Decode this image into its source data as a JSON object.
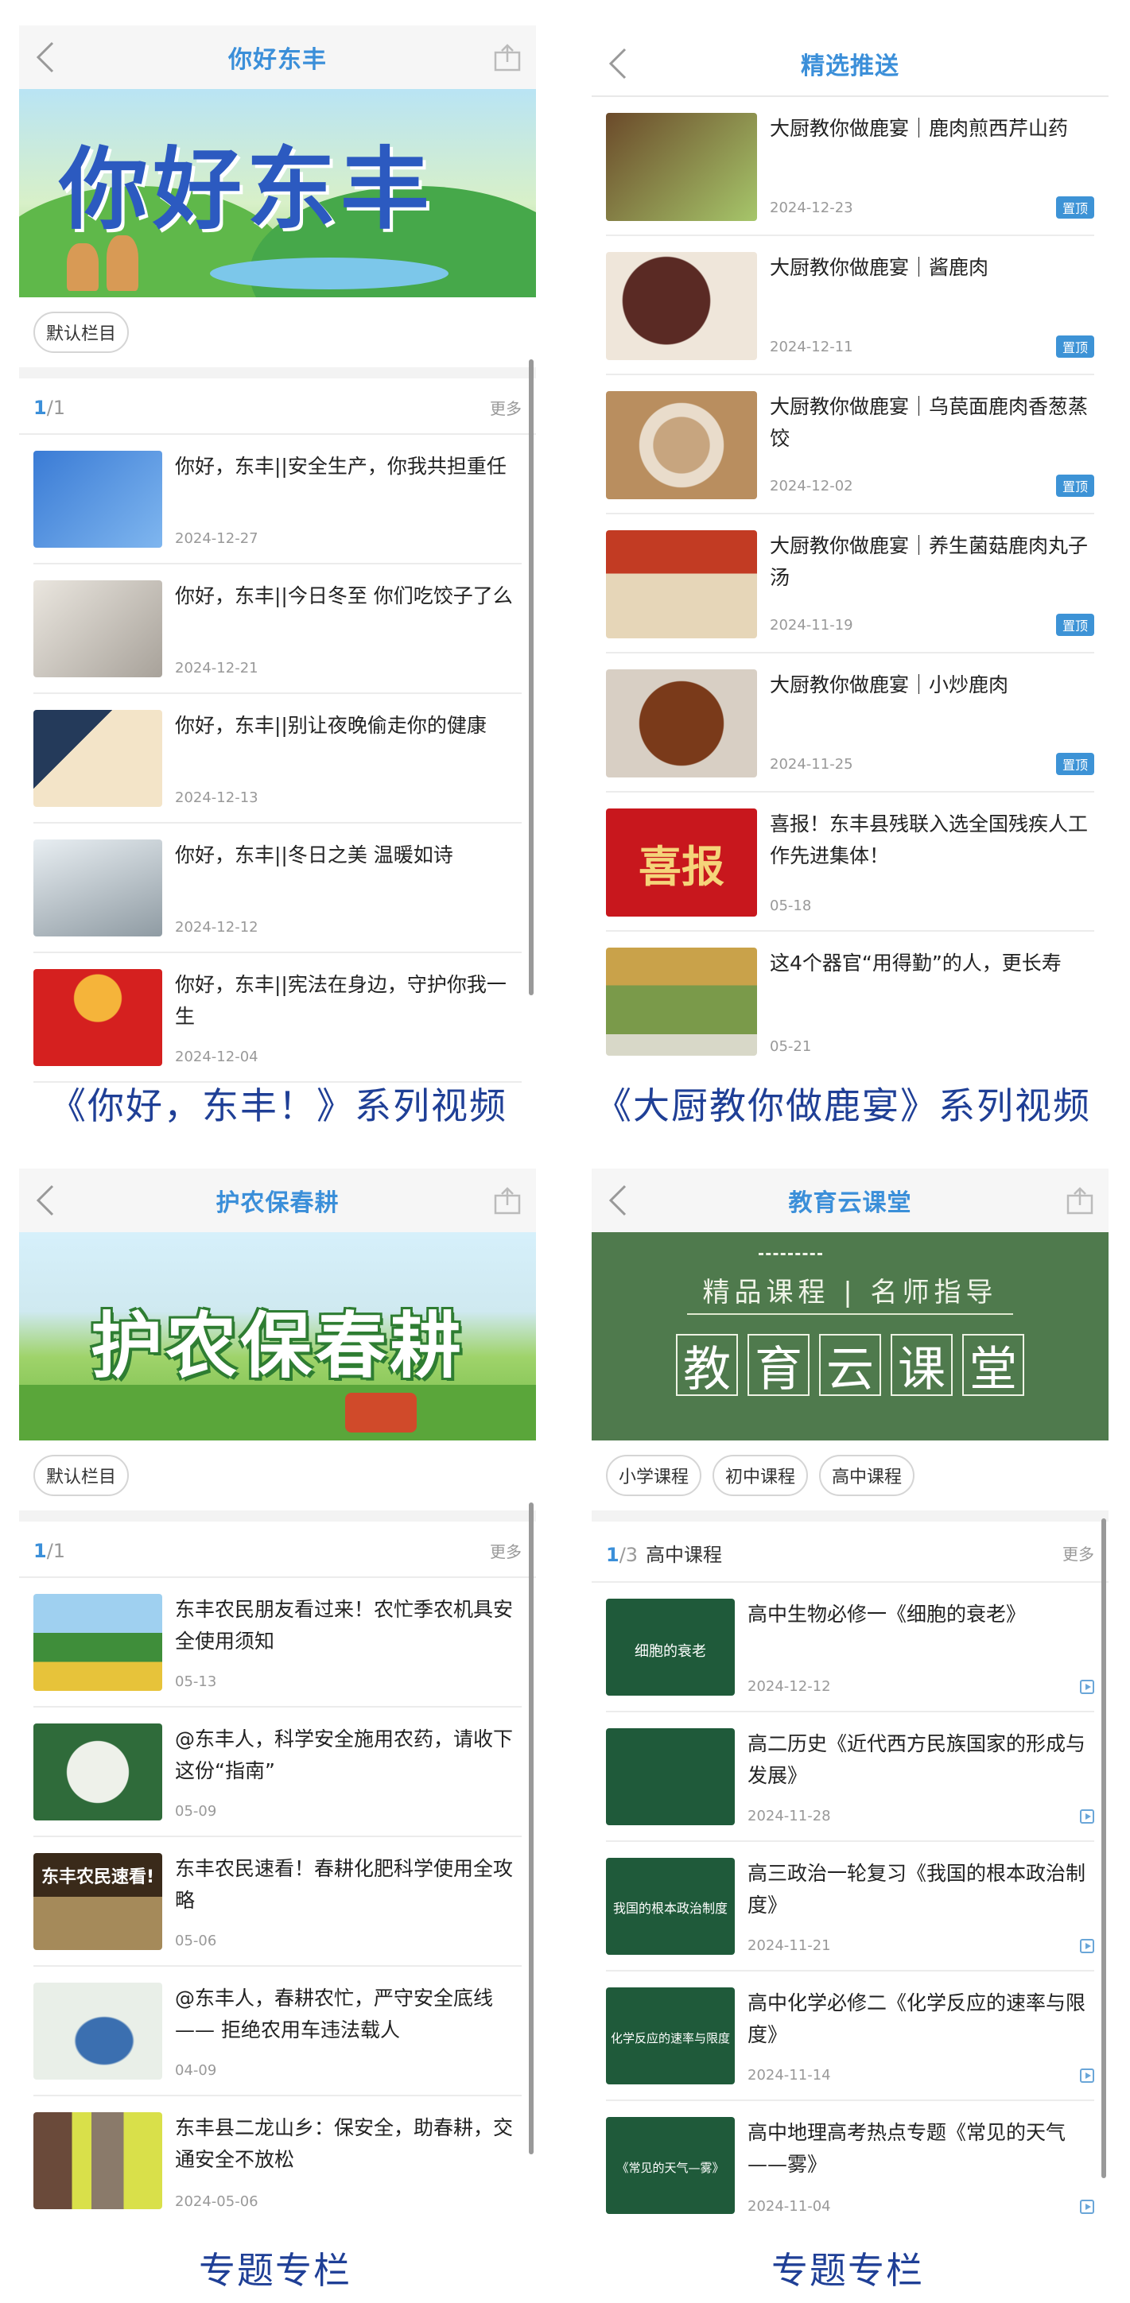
{
  "panels": [
    {
      "title": "你好东丰",
      "chips": [
        "默认栏目"
      ],
      "page_current": "1",
      "page_total": "/1",
      "more": "更多",
      "banner_text": "你好东丰",
      "items": [
        {
          "title": "你好，东丰||安全生产，你我共担重任",
          "date": "2024-12-27",
          "thumb_color": "#3a7bd5"
        },
        {
          "title": "你好，东丰||今日冬至 你们吃饺子了么",
          "date": "2024-12-21",
          "thumb_color": "#d8d2c8"
        },
        {
          "title": "你好，东丰||别让夜晚偷走你的健康",
          "date": "2024-12-13",
          "thumb_color": "#f1e2c6"
        },
        {
          "title": "你好，东丰||冬日之美 温暖如诗",
          "date": "2024-12-12",
          "thumb_color": "#b8c2c8"
        },
        {
          "title": "你好，东丰||宪法在身边，守护你我一生",
          "date": "2024-12-04",
          "thumb_color": "#d5201f"
        }
      ],
      "caption": "《你好，东丰！》系列视频"
    },
    {
      "title": "精选推送",
      "items": [
        {
          "title": "大厨教你做鹿宴｜鹿肉煎西芹山药",
          "date": "2024-12-23",
          "badge": "置顶",
          "thumb_color": "#8a6a3f"
        },
        {
          "title": "大厨教你做鹿宴｜酱鹿肉",
          "date": "2024-12-11",
          "badge": "置顶",
          "thumb_color": "#5a2a24"
        },
        {
          "title": "大厨教你做鹿宴｜乌苠面鹿肉香葱蒸饺",
          "date": "2024-12-02",
          "badge": "置顶",
          "thumb_color": "#c7a57f"
        },
        {
          "title": "大厨教你做鹿宴｜养生菌菇鹿肉丸子汤",
          "date": "2024-11-19",
          "badge": "置顶",
          "thumb_color": "#c23b23"
        },
        {
          "title": "大厨教你做鹿宴｜小炒鹿肉",
          "date": "2024-11-25",
          "badge": "置顶",
          "thumb_color": "#7a3a1a"
        },
        {
          "title": "喜报！东丰县残联入选全国残疾人工作先进集体！",
          "date": "05-18",
          "badge": "",
          "thumb_color": "#c8171d",
          "thumb_text": "喜报"
        },
        {
          "title": "这4个器官“用得勤”的人，更长寿",
          "date": "05-21",
          "badge": "",
          "thumb_color": "#7a9a4a"
        }
      ],
      "caption": "《大厨教你做鹿宴》系列视频"
    },
    {
      "title": "护农保春耕",
      "chips": [
        "默认栏目"
      ],
      "page_current": "1",
      "page_total": "/1",
      "more": "更多",
      "banner_text": "护农保春耕",
      "items": [
        {
          "title": "东丰农民朋友看过来！农忙季农机具安全使用须知",
          "date": "05-13",
          "thumb_color": "#3f8e3a"
        },
        {
          "title": "@东丰人，科学安全施用农药，请收下这份“指南”",
          "date": "05-09",
          "thumb_color": "#2f6b3a"
        },
        {
          "title": "东丰农民速看！春耕化肥科学使用全攻略",
          "date": "05-06",
          "thumb_color": "#6b5a3a",
          "thumb_text": "东丰农民速看!"
        },
        {
          "title": "@东丰人，春耕农忙，严守安全底线—— 拒绝农用车违法载人",
          "date": "04-09",
          "thumb_color": "#e9efe8"
        },
        {
          "title": "东丰县二龙山乡：保安全，助春耕，交通安全不放松",
          "date": "2024-05-06",
          "thumb_color": "#8a7a6a"
        }
      ],
      "caption": "专题专栏"
    },
    {
      "title": "教育云课堂",
      "chips": [
        "小学课程",
        "初中课程",
        "高中课程"
      ],
      "page_current": "1",
      "page_total": "/3",
      "section_label": "高中课程",
      "more": "更多",
      "banner_subtitle": "精品课程 | 名师指导",
      "banner_chars": [
        "教",
        "育",
        "云",
        "课",
        "堂"
      ],
      "items": [
        {
          "title": "高中生物必修一《细胞的衰老》",
          "date": "2024-12-12",
          "thumb_color": "#1f5a3a",
          "thumb_text": "细胞的衰老"
        },
        {
          "title": "高二历史《近代西方民族国家的形成与发展》",
          "date": "2024-11-28",
          "thumb_color": "#1f5a3a",
          "thumb_text": ""
        },
        {
          "title": "高三政治一轮复习《我国的根本政治制度》",
          "date": "2024-11-21",
          "thumb_color": "#1f5a3a",
          "thumb_text": "我国的根本政治制度"
        },
        {
          "title": "高中化学必修二《化学反应的速率与限度》",
          "date": "2024-11-14",
          "thumb_color": "#1f5a3a",
          "thumb_text": "化学反应的速率与限度"
        },
        {
          "title": "高中地理高考热点专题《常见的天气——雾》",
          "date": "2024-11-04",
          "thumb_color": "#1f5a3a",
          "thumb_text": "《常见的天气—雾》"
        }
      ],
      "caption": "专题专栏"
    }
  ],
  "colors": {
    "accent": "#3b8fd9",
    "caption": "#1f3f96",
    "badge": "#3d93d6"
  },
  "icons": {
    "back": "chevron-left-icon",
    "share": "share-icon",
    "play": "play-icon"
  }
}
